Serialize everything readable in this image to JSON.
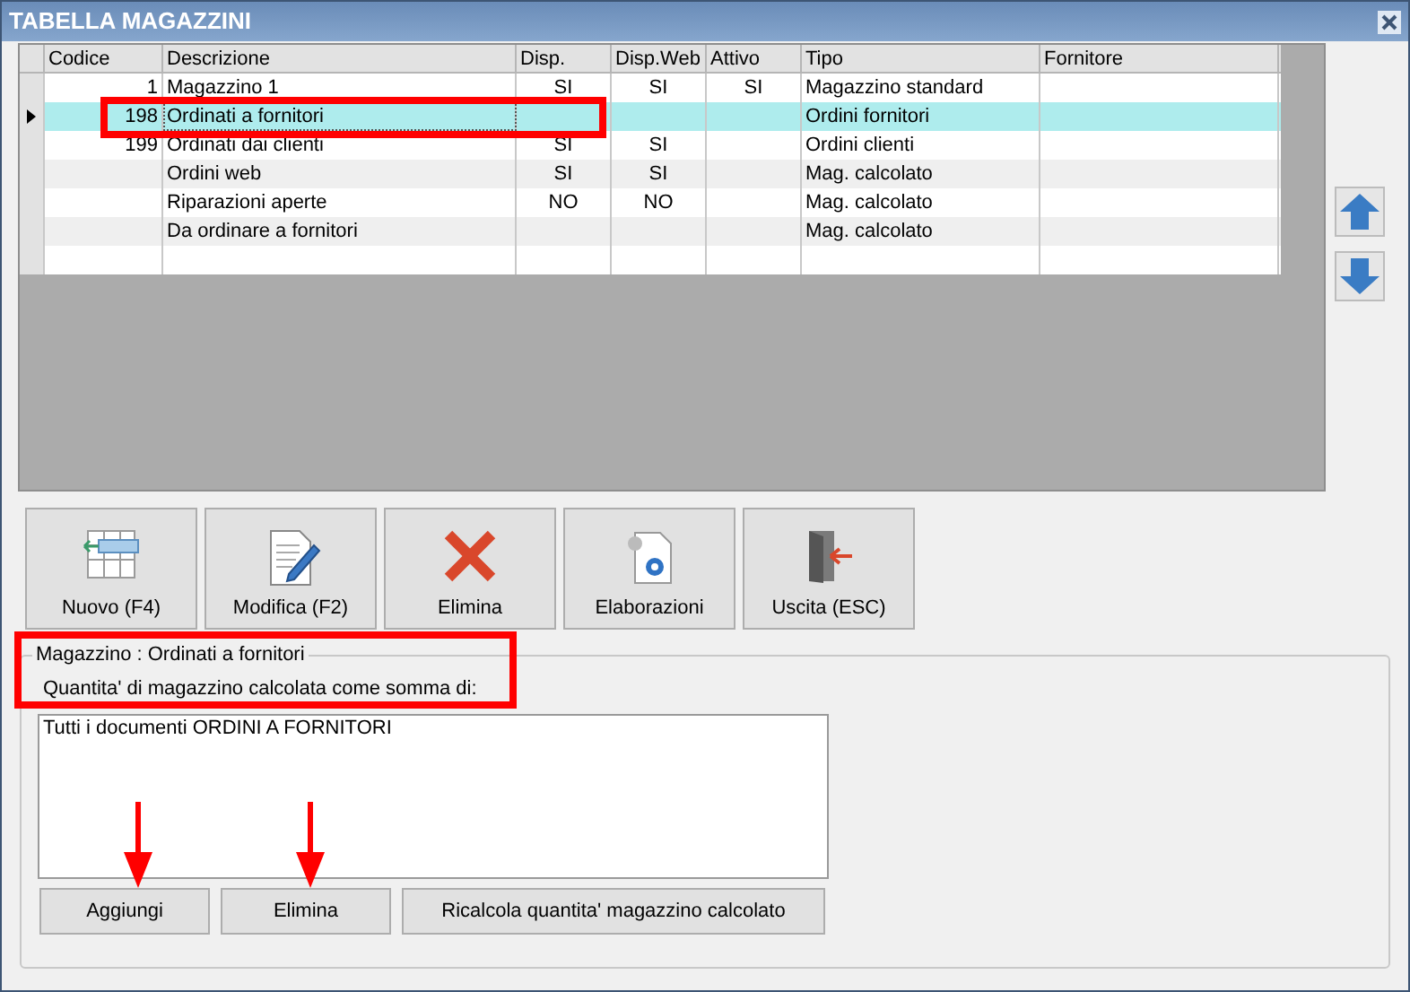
{
  "window": {
    "title": "TABELLA MAGAZZINI"
  },
  "table": {
    "columns": [
      {
        "label": "Codice",
        "kind": "number"
      },
      {
        "label": "Descrizione",
        "kind": "text"
      },
      {
        "label": "Disp.",
        "kind": "flag"
      },
      {
        "label": "Disp.Web",
        "kind": "flag"
      },
      {
        "label": "Attivo",
        "kind": "flag"
      },
      {
        "label": "Tipo",
        "kind": "text"
      },
      {
        "label": "Fornitore",
        "kind": "text"
      }
    ],
    "rows": [
      {
        "cells": [
          "1",
          "Magazzino 1",
          "SI",
          "SI",
          "SI",
          "Magazzino standard",
          null
        ],
        "selected": false
      },
      {
        "cells": [
          "198",
          "Ordinati a fornitori",
          null,
          null,
          null,
          "Ordini fornitori",
          null
        ],
        "selected": true
      },
      {
        "cells": [
          "199",
          "Ordinati dai clienti",
          "SI",
          "SI",
          null,
          "Ordini clienti",
          null
        ],
        "selected": false
      },
      {
        "cells": [
          null,
          "Ordini web",
          "SI",
          "SI",
          null,
          "Mag. calcolato",
          null
        ],
        "selected": false
      },
      {
        "cells": [
          null,
          "Riparazioni aperte",
          "NO",
          "NO",
          null,
          "Mag. calcolato",
          null
        ],
        "selected": false
      },
      {
        "cells": [
          null,
          "Da ordinare a fornitori",
          null,
          null,
          null,
          "Mag. calcolato",
          null
        ],
        "selected": false
      },
      {
        "selected": false
      }
    ]
  },
  "toolbar": [
    {
      "kind": "new",
      "label": "Nuovo (F4)"
    },
    {
      "kind": "edit",
      "label": "Modifica (F2)"
    },
    {
      "kind": "delete",
      "label": "Elimina"
    },
    {
      "kind": "process",
      "label": "Elaborazioni"
    },
    {
      "kind": "exit",
      "label": "Uscita (ESC)"
    }
  ],
  "group": {
    "legend": "Magazzino : Ordinati a fornitori",
    "caption": "Quantita' di magazzino calcolata come somma di:",
    "items": [
      "Tutti i documenti ORDINI A FORNITORI"
    ],
    "buttons": [
      "Aggiungi",
      "Elimina",
      "Ricalcola quantita' magazzino calcolato"
    ]
  }
}
